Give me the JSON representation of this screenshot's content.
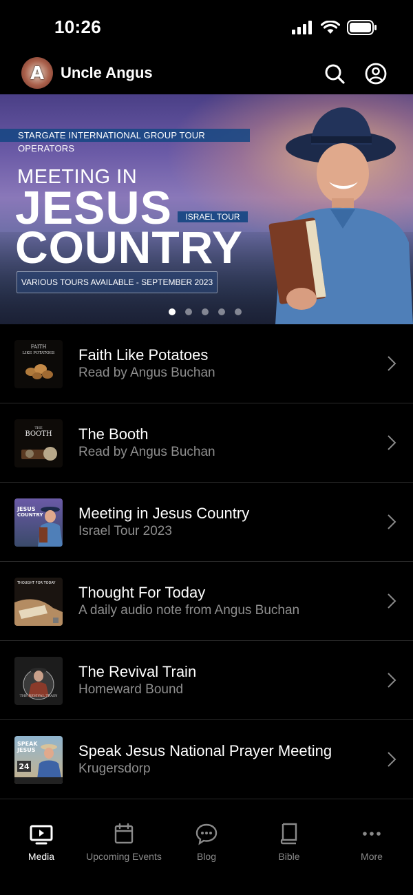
{
  "status_bar": {
    "time": "10:26"
  },
  "header": {
    "title": "Uncle Angus"
  },
  "banner": {
    "ribbon": "STARGATE INTERNATIONAL GROUP TOUR OPERATORS",
    "line1": "MEETING IN",
    "line2": "JESUS",
    "line3": "COUNTRY",
    "tag": "ISRAEL TOUR",
    "tours": "VARIOUS TOURS AVAILABLE - SEPTEMBER 2023",
    "slides": 5,
    "active_slide": 1
  },
  "list": [
    {
      "title": "Faith Like Potatoes",
      "subtitle": "Read by Angus Buchan",
      "thumb_text": "FAITH LIKE POTATOES"
    },
    {
      "title": "The Booth",
      "subtitle": "Read by Angus Buchan",
      "thumb_text": "THE BOOTH"
    },
    {
      "title": "Meeting in Jesus Country",
      "subtitle": "Israel Tour 2023",
      "thumb_text": "JESUS COUNTRY"
    },
    {
      "title": "Thought For Today",
      "subtitle": "A daily audio note from Angus Buchan",
      "thumb_text": "THOUGHT FOR TODAY"
    },
    {
      "title": "The Revival Train",
      "subtitle": "Homeward Bound",
      "thumb_text": "THE REVIVAL TRAIN"
    },
    {
      "title": "Speak Jesus National Prayer Meeting",
      "subtitle": "Krugersdorp",
      "thumb_text": "SPEAK JESUS"
    }
  ],
  "tabs": [
    {
      "label": "Media",
      "icon": "media-icon",
      "active": true
    },
    {
      "label": "Upcoming Events",
      "icon": "calendar-icon",
      "active": false
    },
    {
      "label": "Blog",
      "icon": "chat-bubble-icon",
      "active": false
    },
    {
      "label": "Bible",
      "icon": "book-icon",
      "active": false
    },
    {
      "label": "More",
      "icon": "more-dots-icon",
      "active": false
    }
  ]
}
